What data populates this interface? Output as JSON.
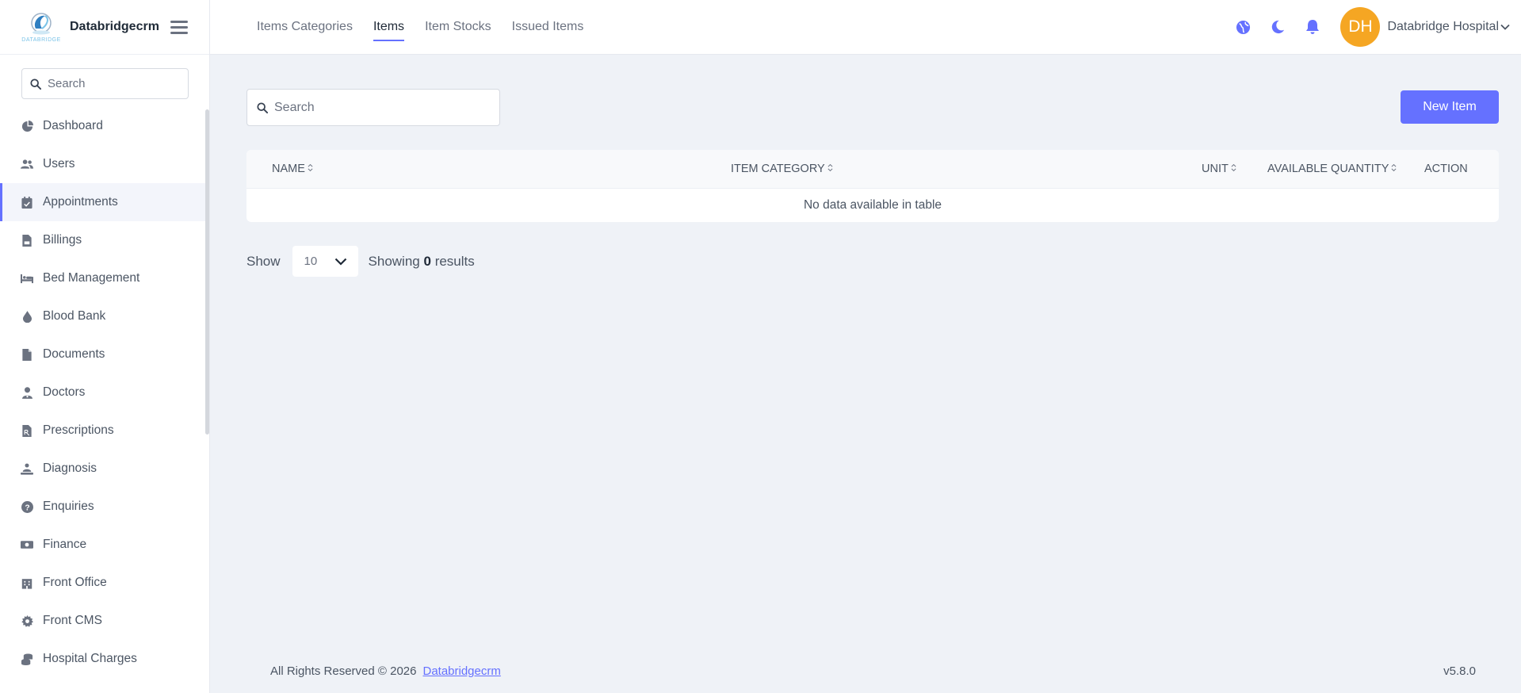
{
  "brand": {
    "logo_text": "DATABRIDGE",
    "name": "Databridgecrm"
  },
  "sidebar": {
    "search_placeholder": "Search",
    "items": [
      {
        "label": "Dashboard",
        "icon": "chart-pie-icon"
      },
      {
        "label": "Users",
        "icon": "users-icon"
      },
      {
        "label": "Appointments",
        "icon": "calendar-check-icon",
        "active": true
      },
      {
        "label": "Billings",
        "icon": "file-invoice-icon"
      },
      {
        "label": "Bed Management",
        "icon": "bed-icon"
      },
      {
        "label": "Blood Bank",
        "icon": "droplet-icon"
      },
      {
        "label": "Documents",
        "icon": "file-icon"
      },
      {
        "label": "Doctors",
        "icon": "user-doctor-icon"
      },
      {
        "label": "Prescriptions",
        "icon": "file-prescription-icon"
      },
      {
        "label": "Diagnosis",
        "icon": "person-diagnosis-icon"
      },
      {
        "label": "Enquiries",
        "icon": "question-circle-icon"
      },
      {
        "label": "Finance",
        "icon": "money-bill-icon"
      },
      {
        "label": "Front Office",
        "icon": "building-icon"
      },
      {
        "label": "Front CMS",
        "icon": "gear-icon"
      },
      {
        "label": "Hospital Charges",
        "icon": "coins-icon"
      }
    ]
  },
  "header": {
    "tabs": [
      {
        "label": "Items Categories"
      },
      {
        "label": "Items",
        "active": true
      },
      {
        "label": "Item Stocks"
      },
      {
        "label": "Issued Items"
      }
    ],
    "avatar_initials": "DH",
    "user_name": "Databridge Hospital",
    "accent": "#6571ff",
    "avatar_color": "#f5a623"
  },
  "main": {
    "search_placeholder": "Search",
    "new_button_label": "New Item",
    "table": {
      "columns": [
        "NAME",
        "ITEM CATEGORY",
        "UNIT",
        "AVAILABLE QUANTITY",
        "ACTION"
      ],
      "empty_message": "No data available in table"
    },
    "pager": {
      "show_label": "Show",
      "page_size": "10",
      "showing_prefix": "Showing",
      "count": "0",
      "showing_suffix": "results"
    }
  },
  "footer": {
    "copyright": "All Rights Reserved © 2026",
    "link_text": "Databridgecrm",
    "version": "v5.8.0"
  }
}
